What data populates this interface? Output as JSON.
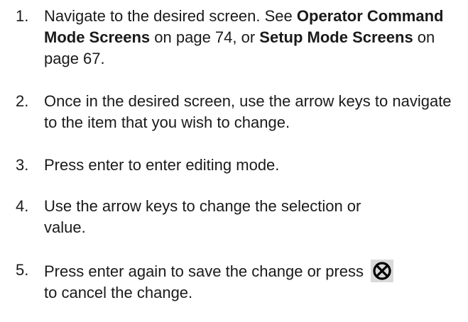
{
  "steps": [
    {
      "number": "1.",
      "parts": {
        "a": "Navigate to the desired screen. See ",
        "b": "Operator Command Mode Screens",
        "c": " on page 74, or ",
        "d": "Setup Mode Screens",
        "e": " on page 67."
      }
    },
    {
      "number": "2.",
      "text": "Once in the desired screen, use the arrow keys to navigate to the item that you wish to change."
    },
    {
      "number": "3.",
      "text": "Press enter to enter editing mode."
    },
    {
      "number": "4.",
      "text": "Use the arrow keys to change the selection or value."
    },
    {
      "number": "5.",
      "text_before_icon": "Press enter again to save the change or press",
      "icon": "cancel-key-icon",
      "text_after_icon": "to cancel the change."
    }
  ],
  "colors": {
    "text": "#1a1a1a",
    "icon_background": "#d9d9d9",
    "icon_symbol": "#000000"
  }
}
